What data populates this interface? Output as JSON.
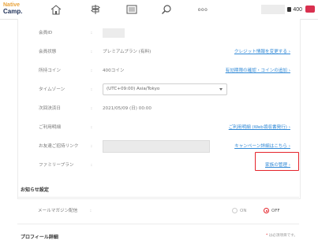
{
  "header": {
    "logo_line1": "Native",
    "logo_line2": "Camp.",
    "coin_count": "400",
    "icons": [
      "home-icon",
      "signpost-icon",
      "book-icon",
      "search-icon",
      "more-icon"
    ],
    "more_glyph": "ooo"
  },
  "account": {
    "rows": [
      {
        "label": "会員ID",
        "value": ""
      },
      {
        "label": "会員状態",
        "value": "プレミアムプラン (有料)",
        "link": "クレジット情報を変更する ›"
      },
      {
        "label": "所持コイン",
        "value": "400コイン",
        "link": "有効期限の確認・コインの追加 ›"
      },
      {
        "label": "タイムゾーン",
        "value": "(UTC+09:00) Asia/Tokyo"
      },
      {
        "label": "次回決済日",
        "value": "2021/05/09 (日) 00:00"
      },
      {
        "label": "ご利用明細",
        "link": "ご利用明細 (Web領収書発行) ›"
      },
      {
        "label": "お友達ご招待リンク",
        "link": "キャンペーン詳細はこちら ›"
      },
      {
        "label": "ファミリープラン",
        "link": "家族の管理 ›"
      }
    ]
  },
  "notifications": {
    "title": "お知らせ設定",
    "mail_label": "メールマガジン配信",
    "on_label": "ON",
    "off_label": "OFF",
    "selected": "OFF"
  },
  "profile": {
    "title": "プロフィール詳細",
    "required_note": "は必須項目です。",
    "required_mark": "*"
  },
  "colors": {
    "link": "#2f88d6",
    "highlight": "#e5242b",
    "logo_orange": "#e8a33b",
    "logo_navy": "#1d2f57"
  }
}
